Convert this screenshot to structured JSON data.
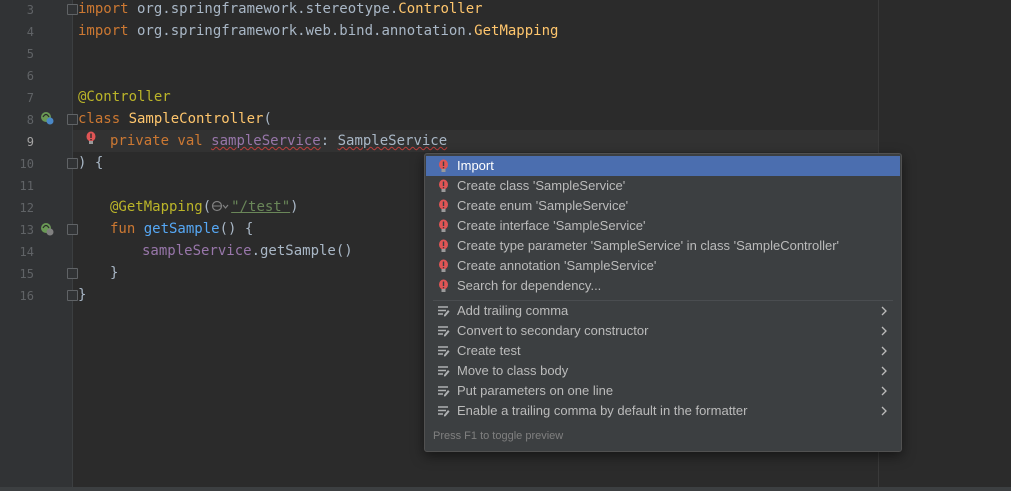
{
  "editor": {
    "lines": [
      {
        "num": "3"
      },
      {
        "num": "4"
      },
      {
        "num": "5"
      },
      {
        "num": "6"
      },
      {
        "num": "7"
      },
      {
        "num": "8"
      },
      {
        "num": "9"
      },
      {
        "num": "10"
      },
      {
        "num": "11"
      },
      {
        "num": "12"
      },
      {
        "num": "13"
      },
      {
        "num": "14"
      },
      {
        "num": "15"
      },
      {
        "num": "16"
      }
    ],
    "code": {
      "l3_kw": "import",
      "l3_pkg": " org.springframework.stereotype.",
      "l3_cls": "Controller",
      "l4_kw": "import",
      "l4_pkg": " org.springframework.web.bind.annotation.",
      "l4_cls": "GetMapping",
      "l7_ann": "@Controller",
      "l8_kw": "class ",
      "l8_cls": "SampleController",
      "l8_rest": "(",
      "l9_kw": "private val ",
      "l9_prop": "sampleService",
      "l9_colon": ": ",
      "l9_type": "SampleService",
      "l10": ") {",
      "l12_ann": "@GetMapping",
      "l12_open": "(",
      "l12_str": "\"/test\"",
      "l12_close": ")",
      "l13_kw": "fun ",
      "l13_fn": "getSample",
      "l13_rest": "() {",
      "l14_prop": "sampleService",
      "l14_rest": ".getSample()",
      "l15": "}",
      "l16": "}"
    }
  },
  "popup": {
    "items": [
      {
        "label": "Import",
        "icon": "error-bulb-icon",
        "submenu": false
      },
      {
        "label": "Create class 'SampleService'",
        "icon": "error-bulb-icon",
        "submenu": false
      },
      {
        "label": "Create enum 'SampleService'",
        "icon": "error-bulb-icon",
        "submenu": false
      },
      {
        "label": "Create interface 'SampleService'",
        "icon": "error-bulb-icon",
        "submenu": false
      },
      {
        "label": "Create type parameter 'SampleService' in class 'SampleController'",
        "icon": "error-bulb-icon",
        "submenu": false
      },
      {
        "label": "Create annotation 'SampleService'",
        "icon": "error-bulb-icon",
        "submenu": false
      },
      {
        "label": "Search for dependency...",
        "icon": "error-bulb-icon",
        "submenu": false
      },
      {
        "label": "Add trailing comma",
        "icon": "intention-icon",
        "submenu": true
      },
      {
        "label": "Convert to secondary constructor",
        "icon": "intention-icon",
        "submenu": true
      },
      {
        "label": "Create test",
        "icon": "intention-icon",
        "submenu": true
      },
      {
        "label": "Move to class body",
        "icon": "intention-icon",
        "submenu": true
      },
      {
        "label": "Put parameters on one line",
        "icon": "intention-icon",
        "submenu": true
      },
      {
        "label": "Enable a trailing comma by default in the formatter",
        "icon": "intention-icon",
        "submenu": true
      }
    ],
    "footer": "Press F1 to toggle preview"
  },
  "colors": {
    "background": "#2b2b2b",
    "selection": "#4b6eaf",
    "keyword": "#cc7832",
    "annotation": "#bbb529",
    "error": "#e05555"
  }
}
